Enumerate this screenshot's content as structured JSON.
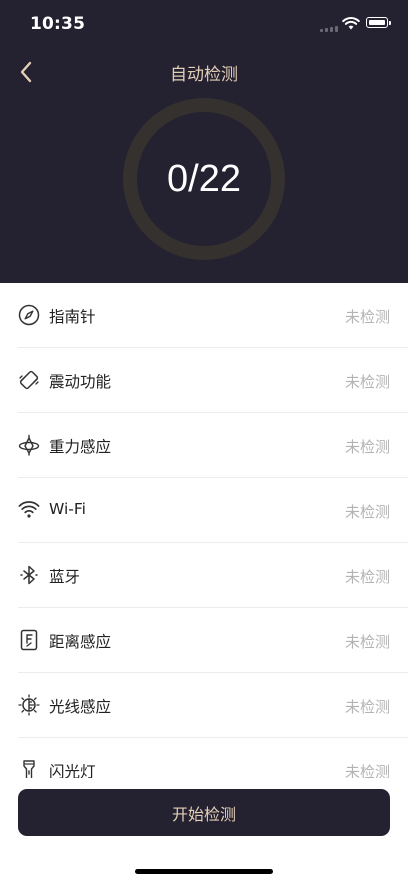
{
  "status_bar": {
    "time": "10:35"
  },
  "nav": {
    "title": "自动检测",
    "back_icon": "chevron-left-icon"
  },
  "progress": {
    "text": "0/22",
    "completed": 0,
    "total": 22
  },
  "checks": [
    {
      "label": "指南针",
      "status": "未检测",
      "icon": "compass-icon"
    },
    {
      "label": "震动功能",
      "status": "未检测",
      "icon": "vibration-icon"
    },
    {
      "label": "重力感应",
      "status": "未检测",
      "icon": "gyroscope-icon"
    },
    {
      "label": "Wi-Fi",
      "status": "未检测",
      "icon": "wifi-icon"
    },
    {
      "label": "蓝牙",
      "status": "未检测",
      "icon": "bluetooth-icon"
    },
    {
      "label": "距离感应",
      "status": "未检测",
      "icon": "proximity-sensor-icon"
    },
    {
      "label": "光线感应",
      "status": "未检测",
      "icon": "light-sensor-icon"
    },
    {
      "label": "闪光灯",
      "status": "未检测",
      "icon": "flashlight-icon"
    }
  ],
  "footer": {
    "start_label": "开始检测"
  },
  "colors": {
    "header_bg": "#242130",
    "accent": "#e3cfb6",
    "status_text": "#b3b3b3"
  }
}
